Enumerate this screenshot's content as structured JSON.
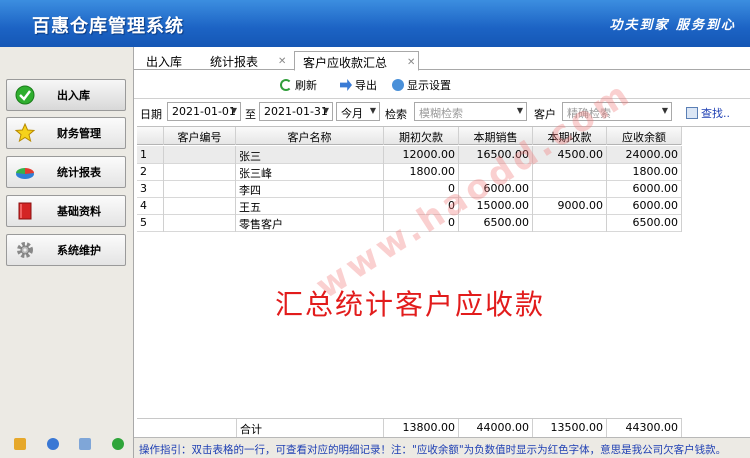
{
  "app": {
    "title": "百惠仓库管理系统",
    "slogan": "功夫到家 服务到心"
  },
  "sidebar": {
    "items": [
      {
        "label": "出入库",
        "icon": "check-circle-icon"
      },
      {
        "label": "财务管理",
        "icon": "star-icon"
      },
      {
        "label": "统计报表",
        "icon": "pie-chart-icon"
      },
      {
        "label": "基础资料",
        "icon": "book-icon"
      },
      {
        "label": "系统维护",
        "icon": "gear-icon"
      }
    ]
  },
  "tabs": [
    {
      "label": "出入库"
    },
    {
      "label": "统计报表"
    },
    {
      "label": "客户应收款汇总"
    }
  ],
  "toolbar": {
    "refresh": "刷新",
    "export": "导出",
    "display_settings": "显示设置"
  },
  "filter": {
    "date_label": "日期",
    "date_from": "2021-01-01",
    "to_label": "至",
    "date_to": "2021-01-31",
    "period": "今月",
    "search_label": "检索",
    "search_placeholder": "模糊检索",
    "customer_label": "客户",
    "customer_placeholder": "精确检索",
    "find": "查找.."
  },
  "table": {
    "columns": [
      "客户编号",
      "客户名称",
      "期初欠款",
      "本期销售",
      "本期收款",
      "应收余额"
    ],
    "rows": [
      {
        "index": "1",
        "id": "",
        "name": "张三",
        "opening": "12000.00",
        "sales": "16500.00",
        "received": "4500.00",
        "balance": "24000.00"
      },
      {
        "index": "2",
        "id": "",
        "name": "张三峰",
        "opening": "1800.00",
        "sales": "",
        "received": "",
        "balance": "1800.00"
      },
      {
        "index": "3",
        "id": "",
        "name": "李四",
        "opening": "0",
        "sales": "6000.00",
        "received": "",
        "balance": "6000.00"
      },
      {
        "index": "4",
        "id": "",
        "name": "王五",
        "opening": "0",
        "sales": "15000.00",
        "received": "9000.00",
        "balance": "6000.00"
      },
      {
        "index": "5",
        "id": "",
        "name": "零售客户",
        "opening": "0",
        "sales": "6500.00",
        "received": "",
        "balance": "6500.00"
      }
    ],
    "total": {
      "label": "合计",
      "opening": "13800.00",
      "sales": "44000.00",
      "received": "13500.00",
      "balance": "44300.00"
    }
  },
  "overlay": {
    "caption": "汇总统计客户应收款",
    "watermark": "www.haodd.com"
  },
  "status": "操作指引：双击表格的一行，可查看对应的明细记录！注：\"应收余额\"为负数值时显示为红色字体，意思是我公司欠客户钱款。",
  "colors": {
    "header": "#1c63c4",
    "caption": "#e21c1c",
    "status_text": "#1e3fb3"
  }
}
